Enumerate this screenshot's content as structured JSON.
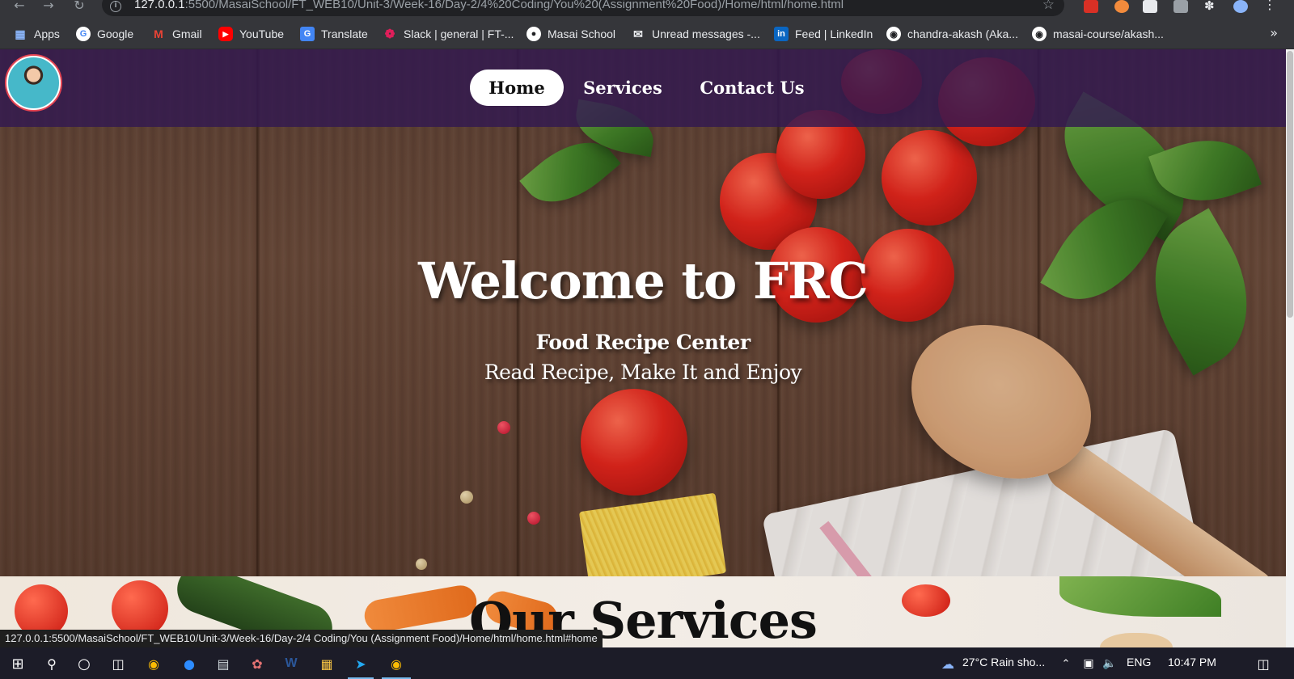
{
  "browser": {
    "url_host": "127.0.0.1",
    "url_path": ":5500/MasaiSchool/FT_WEB10/Unit-3/Week-16/Day-2/4%20Coding/You%20(Assignment%20Food)/Home/html/home.html",
    "bookmarks": [
      {
        "label": "Apps",
        "icon": "apps-grid-icon"
      },
      {
        "label": "Google",
        "icon": "google-icon"
      },
      {
        "label": "Gmail",
        "icon": "gmail-icon"
      },
      {
        "label": "YouTube",
        "icon": "youtube-icon"
      },
      {
        "label": "Translate",
        "icon": "translate-icon"
      },
      {
        "label": "Slack | general | FT-...",
        "icon": "slack-icon"
      },
      {
        "label": "Masai School",
        "icon": "masai-icon"
      },
      {
        "label": "Unread messages -...",
        "icon": "messages-icon"
      },
      {
        "label": "Feed | LinkedIn",
        "icon": "linkedin-icon"
      },
      {
        "label": "chandra-akash (Aka...",
        "icon": "github-icon"
      },
      {
        "label": "masai-course/akash...",
        "icon": "github-icon"
      }
    ],
    "more_bookmarks": "»",
    "status_link": "127.0.0.1:5500/MasaiSchool/FT_WEB10/Unit-3/Week-16/Day-2/4 Coding/You (Assignment Food)/Home/html/home.html#home"
  },
  "nav": {
    "items": [
      {
        "label": "Home",
        "active": true
      },
      {
        "label": "Services",
        "active": false
      },
      {
        "label": "Contact Us",
        "active": false
      }
    ]
  },
  "hero": {
    "title": "Welcome to FRC",
    "subtitle": "Food Recipe Center",
    "tagline": "Read Recipe, Make It and Enjoy"
  },
  "services": {
    "heading": "Our Services"
  },
  "taskbar": {
    "weather": "27°C  Rain sho...",
    "language": "ENG",
    "time": "10:47 PM"
  },
  "colors": {
    "navbar": "#321850",
    "active_pill": "#ffffff",
    "hero_wood": "#5d4132"
  }
}
